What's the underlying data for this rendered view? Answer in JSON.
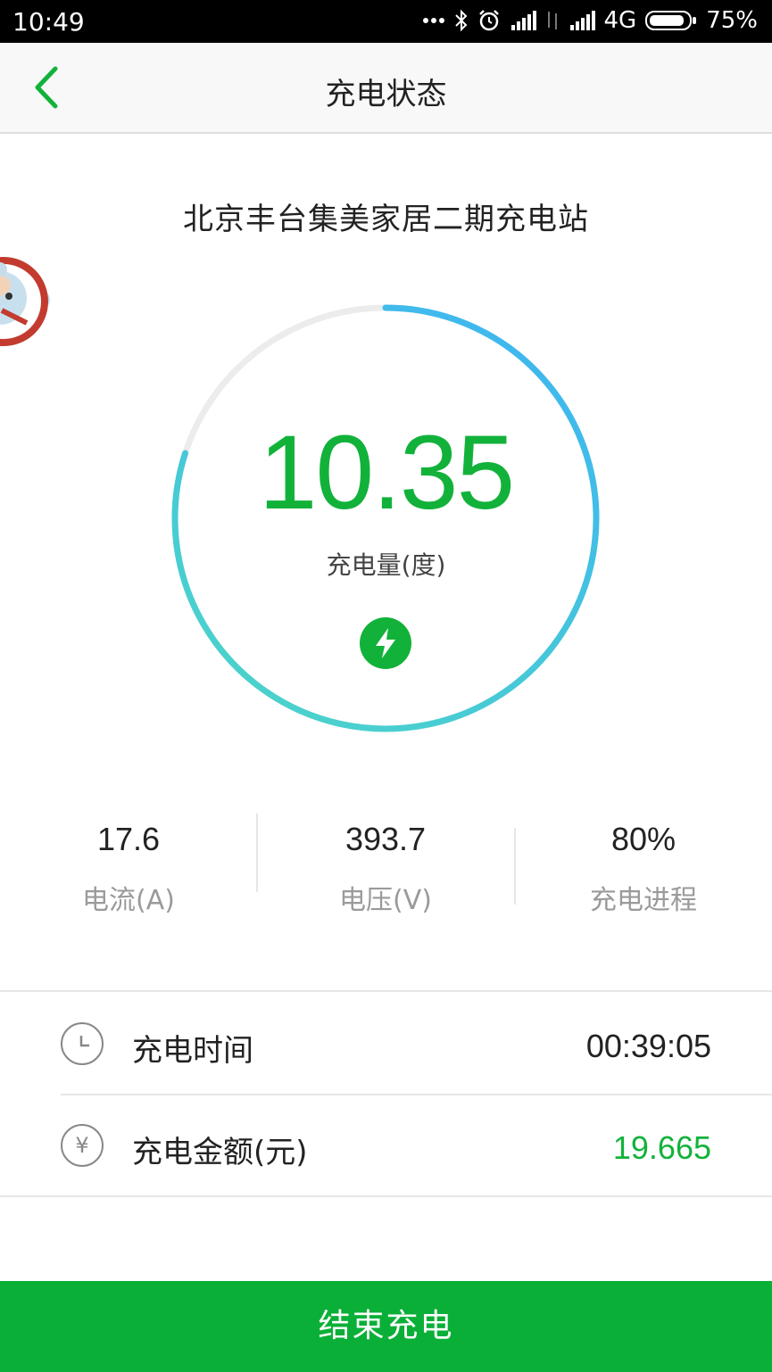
{
  "status_bar": {
    "time": "10:49",
    "network": "4G",
    "battery": "75%"
  },
  "nav": {
    "title": "充电状态",
    "back_icon": "chevron-left-icon"
  },
  "station": {
    "name": "北京丰台集美家居二期充电站"
  },
  "gauge": {
    "value": "10.35",
    "label": "充电量(度)",
    "progress": 0.8,
    "colors": {
      "track": "#ececec",
      "start": "#4cd6c6",
      "end": "#3fb8ee"
    }
  },
  "metrics": [
    {
      "value": "17.6",
      "label": "电流(A)"
    },
    {
      "value": "393.7",
      "label": "电压(V)"
    },
    {
      "value": "80%",
      "label": "充电进程"
    }
  ],
  "info": {
    "time_label": "充电时间",
    "time_value": "00:39:05",
    "amount_label": "充电金额(元)",
    "amount_value": "19.665",
    "yen_symbol": "¥"
  },
  "actions": {
    "end_charge": "结束充电"
  },
  "colors": {
    "brand_green": "#12b23a"
  }
}
